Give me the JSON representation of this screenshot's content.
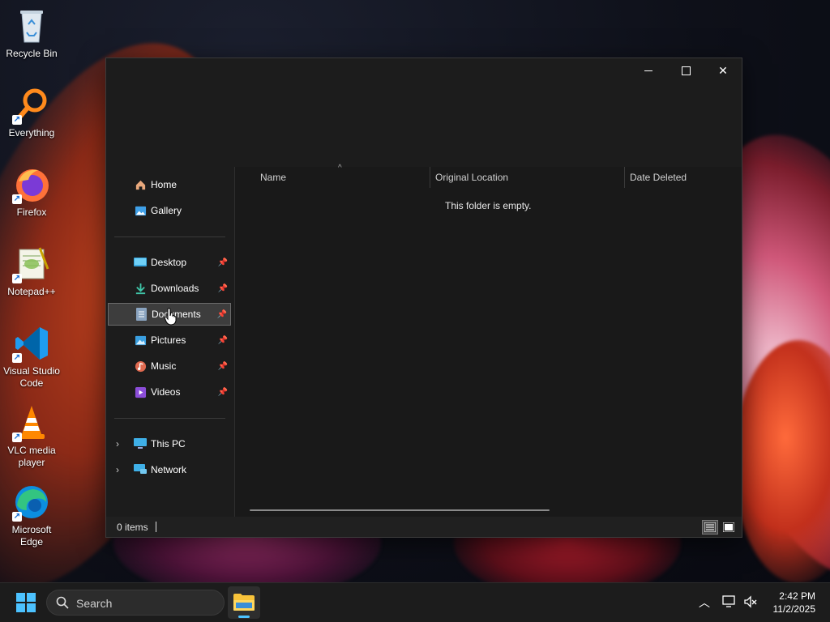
{
  "desktop": {
    "icons": [
      {
        "label": "Recycle Bin",
        "icon": "recycle-bin-icon"
      },
      {
        "label": "Everything",
        "icon": "everything-icon"
      },
      {
        "label": "Firefox",
        "icon": "firefox-icon"
      },
      {
        "label": "Notepad++",
        "icon": "notepad-plus-plus-icon"
      },
      {
        "label": "Visual Studio Code",
        "icon": "vscode-icon"
      },
      {
        "label": "VLC media player",
        "icon": "vlc-icon"
      },
      {
        "label": "Microsoft Edge",
        "icon": "edge-icon"
      }
    ]
  },
  "window": {
    "controls": {
      "minimize": "minimize",
      "maximize": "maximize",
      "close": "close"
    },
    "nav": {
      "quick": [
        {
          "label": "Home",
          "icon": "home-icon"
        },
        {
          "label": "Gallery",
          "icon": "gallery-icon"
        }
      ],
      "pinned": [
        {
          "label": "Desktop",
          "icon": "desktop-folder-icon"
        },
        {
          "label": "Downloads",
          "icon": "downloads-icon"
        },
        {
          "label": "Documents",
          "icon": "documents-icon",
          "selected": true
        },
        {
          "label": "Pictures",
          "icon": "pictures-icon"
        },
        {
          "label": "Music",
          "icon": "music-icon"
        },
        {
          "label": "Videos",
          "icon": "videos-icon"
        }
      ],
      "tree": [
        {
          "label": "This PC",
          "icon": "this-pc-icon"
        },
        {
          "label": "Network",
          "icon": "network-icon"
        }
      ]
    },
    "columns": [
      "Name",
      "Original Location",
      "Date Deleted"
    ],
    "empty_message": "This folder is empty.",
    "status": {
      "items": "0 items"
    }
  },
  "taskbar": {
    "search_label": "Search",
    "clock": {
      "time": "2:42 PM",
      "date": "11/2/2025"
    }
  },
  "colors": {
    "accent": "#4cc2ff",
    "window_bg": "#202020",
    "selected_bg": "#3d3d3d"
  }
}
